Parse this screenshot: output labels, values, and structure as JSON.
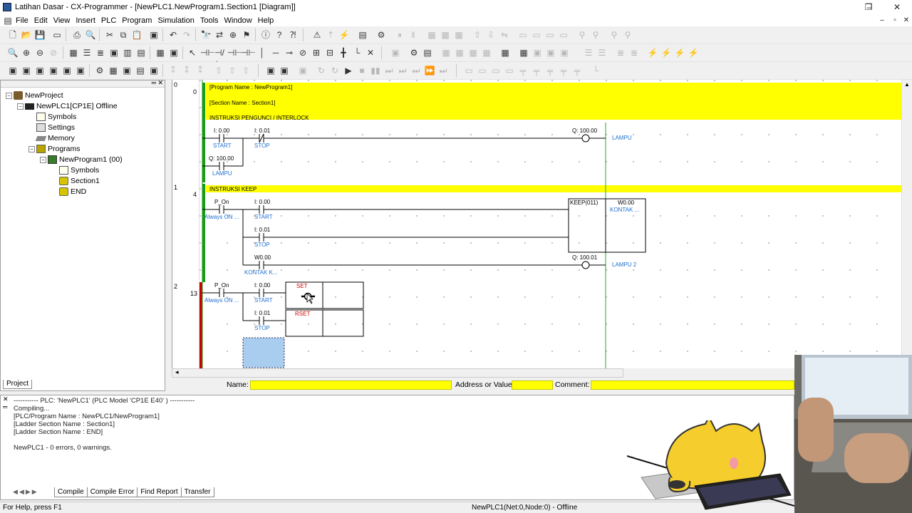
{
  "window": {
    "title": "Latihan Dasar - CX-Programmer - [NewPLC1.NewProgram1.Section1 [Diagram]]",
    "controls": [
      "–",
      "❐",
      "✕"
    ],
    "inner_controls": [
      "–",
      "▫",
      "✕"
    ]
  },
  "menu": [
    "File",
    "Edit",
    "View",
    "Insert",
    "PLC",
    "Program",
    "Simulation",
    "Tools",
    "Window",
    "Help"
  ],
  "project_tree": {
    "items": [
      {
        "label": "NewProject",
        "level": 0,
        "icon": "project-icon"
      },
      {
        "label": "NewPLC1[CP1E] Offline",
        "level": 1,
        "icon": "plc-icon"
      },
      {
        "label": "Symbols",
        "level": 2,
        "icon": "symbols-icon"
      },
      {
        "label": "Settings",
        "level": 2,
        "icon": "settings-icon"
      },
      {
        "label": "Memory",
        "level": 2,
        "icon": "memory-icon"
      },
      {
        "label": "Programs",
        "level": 2,
        "icon": "programs-icon"
      },
      {
        "label": "NewProgram1 (00)",
        "level": 3,
        "icon": "program-icon"
      },
      {
        "label": "Symbols",
        "level": 4,
        "icon": "symbols-icon"
      },
      {
        "label": "Section1",
        "level": 4,
        "icon": "section-icon"
      },
      {
        "label": "END",
        "level": 4,
        "icon": "section-icon"
      }
    ],
    "tab": "Project"
  },
  "ladder": {
    "rungs": [
      {
        "number": "0",
        "step": "0",
        "comments": [
          "[Program Name : NewProgram1]",
          "[Section Name : Section1]",
          "INSTRUKSI PENGUNCI / INTERLOCK"
        ],
        "contacts": [
          {
            "addr": "I: 0.00",
            "label": "START",
            "type": "no"
          },
          {
            "addr": "I: 0.01",
            "label": "STOP",
            "type": "nc"
          },
          {
            "addr": "Q: 100.00",
            "label": "LAMPU",
            "type": "no"
          }
        ],
        "coil": {
          "addr": "Q: 100.00",
          "label": "LAMPU"
        }
      },
      {
        "number": "1",
        "step": "4",
        "comments": [
          "INSTRUKSI KEEP"
        ],
        "contacts": [
          {
            "addr": "P_On",
            "label": "Always ON ...",
            "type": "no"
          },
          {
            "addr": "I: 0.00",
            "label": "START",
            "type": "no"
          },
          {
            "addr": "I: 0.01",
            "label": "STOP",
            "type": "no"
          },
          {
            "addr": "W0.00",
            "label": "KONTAK K...",
            "type": "no"
          }
        ],
        "keep": {
          "name": "KEEP(011)",
          "addr": "W0.00",
          "label": "KONTAK ..."
        },
        "coil": {
          "addr": "Q: 100.01",
          "label": "LAMPU 2"
        }
      },
      {
        "number": "2",
        "step": "13",
        "contacts": [
          {
            "addr": "P_On",
            "label": "Always ON ...",
            "type": "no"
          },
          {
            "addr": "I: 0.00",
            "label": "START",
            "type": "no"
          },
          {
            "addr": "I: 0.01",
            "label": "STOP",
            "type": "no"
          }
        ],
        "set_label": "SET",
        "rset_label": "RSET"
      }
    ]
  },
  "name_bar": {
    "name_label": "Name:",
    "address_label": "Address or Value:",
    "comment_label": "Comment:"
  },
  "output": {
    "lines": [
      "----------- PLC: 'NewPLC1' (PLC Model 'CP1E E40' ) -----------",
      "Compiling...",
      "[PLC/Program Name : NewPLC1/NewProgram1]",
      "[Ladder Section Name : Section1]",
      "[Ladder Section Name : END]",
      "",
      "NewPLC1 - 0 errors, 0 warnings."
    ],
    "tabs": [
      "Compile",
      "Compile Error",
      "Find Report",
      "Transfer"
    ]
  },
  "status": {
    "help": "For Help, press F1",
    "plc": "NewPLC1(Net:0,Node:0) - Offline"
  },
  "colors": {
    "comment_bg": "#ffff00",
    "rung_marker": "#1a9a1a",
    "error_marker": "#cc0000",
    "label_blue": "#1f6fd1",
    "set_red": "#cc0000"
  }
}
